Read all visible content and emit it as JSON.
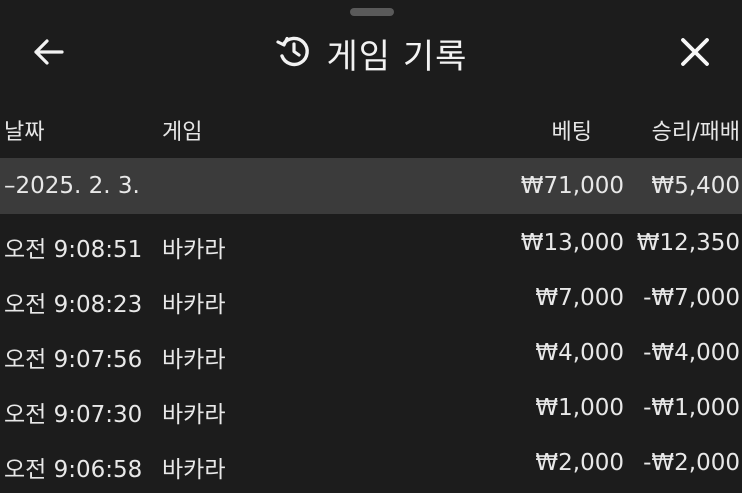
{
  "header": {
    "title": "게임 기록",
    "back_icon": "arrow-left-icon",
    "history_icon": "history-icon",
    "close_icon": "close-icon"
  },
  "columns": {
    "date": "날짜",
    "game": "게임",
    "bet": "베팅",
    "result": "승리/패배"
  },
  "date_group": {
    "label": "–2025. 2. 3.",
    "bet_total": "₩71,000",
    "result_total": "₩5,400"
  },
  "rows": [
    {
      "time": "오전 9:08:51",
      "game": "바카라",
      "bet": "₩13,000",
      "result": "₩12,350"
    },
    {
      "time": "오전 9:08:23",
      "game": "바카라",
      "bet": "₩7,000",
      "result": "-₩7,000"
    },
    {
      "time": "오전 9:07:56",
      "game": "바카라",
      "bet": "₩4,000",
      "result": "-₩4,000"
    },
    {
      "time": "오전 9:07:30",
      "game": "바카라",
      "bet": "₩1,000",
      "result": "-₩1,000"
    },
    {
      "time": "오전 9:06:58",
      "game": "바카라",
      "bet": "₩2,000",
      "result": "-₩2,000"
    }
  ]
}
